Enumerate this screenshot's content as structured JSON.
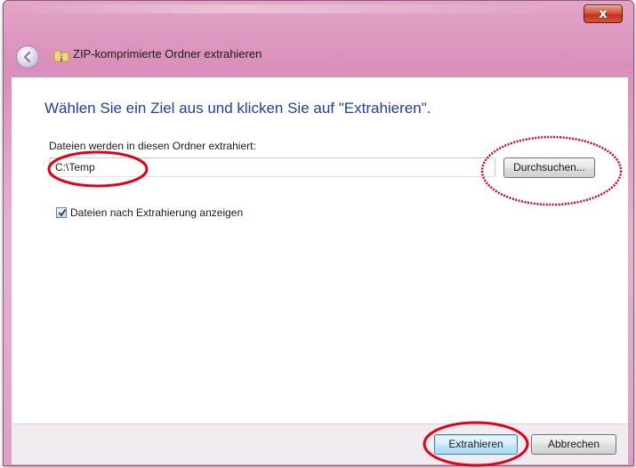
{
  "window": {
    "title": "ZIP-komprimierte Ordner extrahieren",
    "close_glyph": "x",
    "back_icon": "back-arrow-icon",
    "title_icon": "zip-folder-icon"
  },
  "dialog": {
    "heading": "Wählen Sie ein Ziel aus und klicken Sie auf \"Extrahieren\".",
    "field_label": "Dateien werden in diesen Ordner extrahiert:",
    "path_value": "C:\\Temp",
    "browse_label": "Durchsuchen...",
    "checkbox_label": "Dateien nach Extrahierung anzeigen",
    "checkbox_checked": true
  },
  "footer": {
    "extract_label": "Extrahieren",
    "cancel_label": "Abbrechen"
  },
  "colors": {
    "heading": "#1f3fa0",
    "annotation": "#e3001b",
    "titlebar": "#d98fbb"
  }
}
